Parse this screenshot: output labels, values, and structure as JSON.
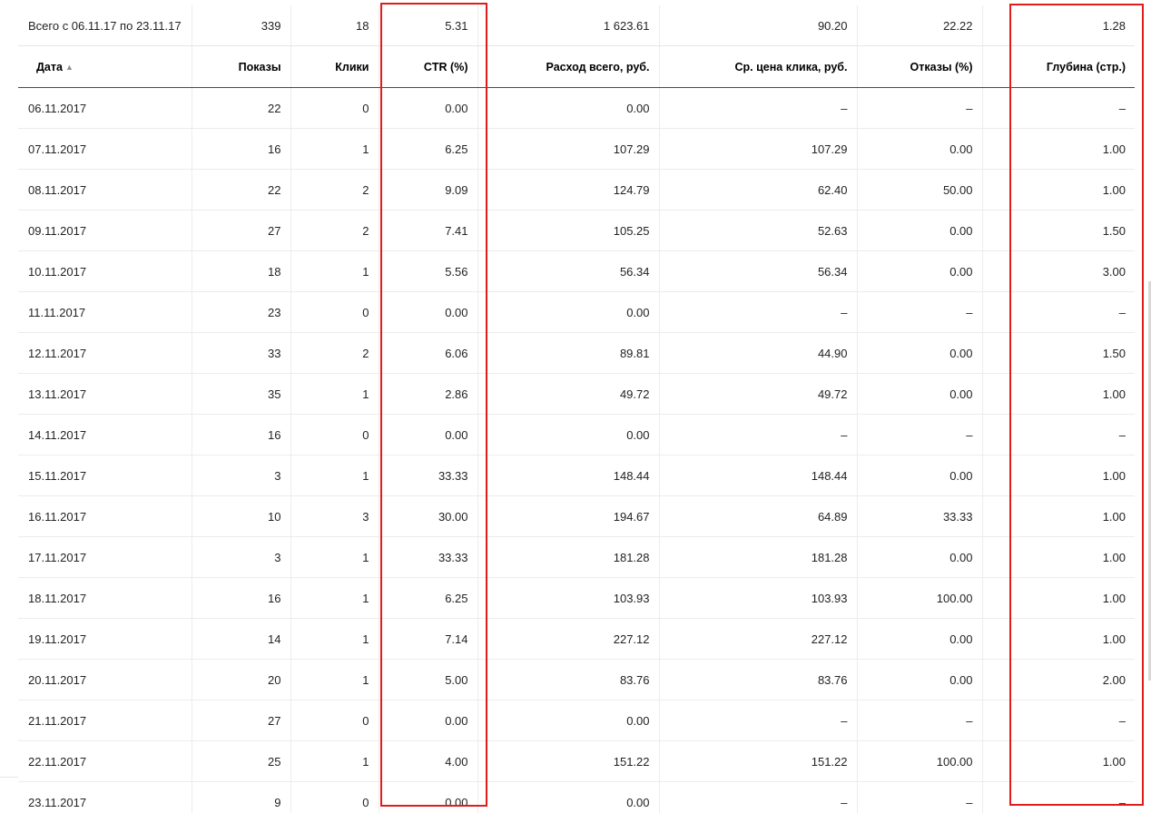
{
  "highlight_color": "#e21b1b",
  "total_row": {
    "period": "Всего с 06.11.17 по 23.11.17",
    "impressions": "339",
    "clicks": "18",
    "ctr": "5.31",
    "spend": "1 623.61",
    "avg_cpc": "90.20",
    "bounces": "22.22",
    "depth": "1.28"
  },
  "columns": {
    "date": "Дата",
    "impressions": "Показы",
    "clicks": "Клики",
    "ctr": "CTR (%)",
    "spend": "Расход всего, руб.",
    "avg_cpc": "Ср. цена клика, руб.",
    "bounces": "Отказы (%)",
    "depth": "Глубина (стр.)"
  },
  "sort": {
    "column": "date",
    "indicator": "▲"
  },
  "rows": [
    [
      "06.11.2017",
      "22",
      "0",
      "0.00",
      "0.00",
      "–",
      "–",
      "–"
    ],
    [
      "07.11.2017",
      "16",
      "1",
      "6.25",
      "107.29",
      "107.29",
      "0.00",
      "1.00"
    ],
    [
      "08.11.2017",
      "22",
      "2",
      "9.09",
      "124.79",
      "62.40",
      "50.00",
      "1.00"
    ],
    [
      "09.11.2017",
      "27",
      "2",
      "7.41",
      "105.25",
      "52.63",
      "0.00",
      "1.50"
    ],
    [
      "10.11.2017",
      "18",
      "1",
      "5.56",
      "56.34",
      "56.34",
      "0.00",
      "3.00"
    ],
    [
      "11.11.2017",
      "23",
      "0",
      "0.00",
      "0.00",
      "–",
      "–",
      "–"
    ],
    [
      "12.11.2017",
      "33",
      "2",
      "6.06",
      "89.81",
      "44.90",
      "0.00",
      "1.50"
    ],
    [
      "13.11.2017",
      "35",
      "1",
      "2.86",
      "49.72",
      "49.72",
      "0.00",
      "1.00"
    ],
    [
      "14.11.2017",
      "16",
      "0",
      "0.00",
      "0.00",
      "–",
      "–",
      "–"
    ],
    [
      "15.11.2017",
      "3",
      "1",
      "33.33",
      "148.44",
      "148.44",
      "0.00",
      "1.00"
    ],
    [
      "16.11.2017",
      "10",
      "3",
      "30.00",
      "194.67",
      "64.89",
      "33.33",
      "1.00"
    ],
    [
      "17.11.2017",
      "3",
      "1",
      "33.33",
      "181.28",
      "181.28",
      "0.00",
      "1.00"
    ],
    [
      "18.11.2017",
      "16",
      "1",
      "6.25",
      "103.93",
      "103.93",
      "100.00",
      "1.00"
    ],
    [
      "19.11.2017",
      "14",
      "1",
      "7.14",
      "227.12",
      "227.12",
      "0.00",
      "1.00"
    ],
    [
      "20.11.2017",
      "20",
      "1",
      "5.00",
      "83.76",
      "83.76",
      "0.00",
      "2.00"
    ],
    [
      "21.11.2017",
      "27",
      "0",
      "0.00",
      "0.00",
      "–",
      "–",
      "–"
    ],
    [
      "22.11.2017",
      "25",
      "1",
      "4.00",
      "151.22",
      "151.22",
      "100.00",
      "1.00"
    ],
    [
      "23.11.2017",
      "9",
      "0",
      "0.00",
      "0.00",
      "–",
      "–",
      "–"
    ]
  ]
}
